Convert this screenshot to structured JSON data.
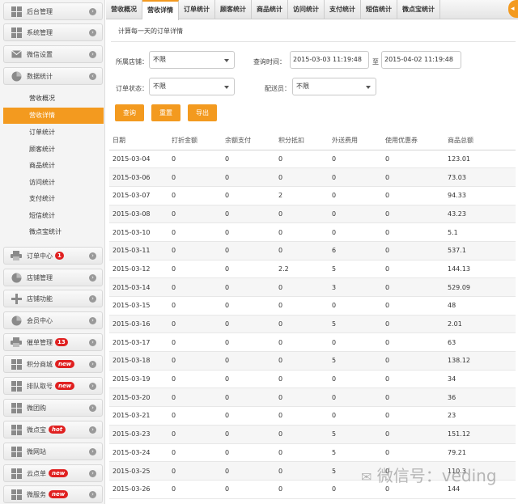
{
  "sidebar": {
    "items": [
      {
        "label": "后台管理",
        "icon": "grid-icon"
      },
      {
        "label": "系统管理",
        "icon": "grid-icon"
      },
      {
        "label": "微信设置",
        "icon": "mail-icon"
      },
      {
        "label": "数据统计",
        "icon": "pie-chart-icon"
      }
    ],
    "sub_items": [
      "营收概况",
      "营收详情",
      "订单统计",
      "顾客统计",
      "商品统计",
      "访问统计",
      "支付统计",
      "短信统计",
      "微点宝统计"
    ],
    "items_lower": [
      {
        "label": "订单中心",
        "icon": "printer-icon",
        "badge": "1"
      },
      {
        "label": "店铺管理",
        "icon": "pie-chart-icon"
      },
      {
        "label": "店铺功能",
        "icon": "plus-icon"
      },
      {
        "label": "会员中心",
        "icon": "pie-chart-icon"
      },
      {
        "label": "催单管理",
        "icon": "printer-icon",
        "badge": "13"
      },
      {
        "label": "积分商城",
        "icon": "grid-icon",
        "new": "new"
      },
      {
        "label": "排队取号",
        "icon": "grid-icon",
        "new": "new"
      },
      {
        "label": "微团购",
        "icon": "grid-icon"
      },
      {
        "label": "微点宝",
        "icon": "grid-icon",
        "new": "hot"
      },
      {
        "label": "微网站",
        "icon": "grid-icon"
      },
      {
        "label": "云点单",
        "icon": "grid-icon",
        "new": "new"
      },
      {
        "label": "微服务",
        "icon": "grid-icon",
        "new": "new"
      }
    ]
  },
  "tabs": [
    "营收概况",
    "营收详情",
    "订单统计",
    "顾客统计",
    "商品统计",
    "访问统计",
    "支付统计",
    "短信统计",
    "微点宝统计"
  ],
  "page": {
    "description": "计算每一天的订单详情",
    "store_label": "所属店铺：",
    "store_value": "不限",
    "query_time_label": "查询时间：",
    "start_time": "2015-03-03 11:19:48",
    "to_label": "至",
    "end_time": "2015-04-02 11:19:48",
    "order_status_label": "订单状态：",
    "order_status_value": "不限",
    "courier_label": "配送员：",
    "courier_value": "不限",
    "query_button": "查询",
    "reset_button": "重置",
    "export_button": "导出"
  },
  "table": {
    "headers": [
      "日期",
      "打折金额",
      "余额支付",
      "积分抵扣",
      "外送费用",
      "使用优惠券",
      "商品总额"
    ],
    "rows": [
      [
        "2015-03-04",
        "0",
        "0",
        "0",
        "0",
        "0",
        "123.01"
      ],
      [
        "2015-03-06",
        "0",
        "0",
        "0",
        "0",
        "0",
        "73.03"
      ],
      [
        "2015-03-07",
        "0",
        "0",
        "2",
        "0",
        "0",
        "94.33"
      ],
      [
        "2015-03-08",
        "0",
        "0",
        "0",
        "0",
        "0",
        "43.23"
      ],
      [
        "2015-03-10",
        "0",
        "0",
        "0",
        "0",
        "0",
        "5.1"
      ],
      [
        "2015-03-11",
        "0",
        "0",
        "0",
        "6",
        "0",
        "537.1"
      ],
      [
        "2015-03-12",
        "0",
        "0",
        "2.2",
        "5",
        "0",
        "144.13"
      ],
      [
        "2015-03-14",
        "0",
        "0",
        "0",
        "3",
        "0",
        "529.09"
      ],
      [
        "2015-03-15",
        "0",
        "0",
        "0",
        "0",
        "0",
        "48"
      ],
      [
        "2015-03-16",
        "0",
        "0",
        "0",
        "5",
        "0",
        "2.01"
      ],
      [
        "2015-03-17",
        "0",
        "0",
        "0",
        "0",
        "0",
        "63"
      ],
      [
        "2015-03-18",
        "0",
        "0",
        "0",
        "5",
        "0",
        "138.12"
      ],
      [
        "2015-03-19",
        "0",
        "0",
        "0",
        "0",
        "0",
        "34"
      ],
      [
        "2015-03-20",
        "0",
        "0",
        "0",
        "0",
        "0",
        "36"
      ],
      [
        "2015-03-21",
        "0",
        "0",
        "0",
        "0",
        "0",
        "23"
      ],
      [
        "2015-03-23",
        "0",
        "0",
        "0",
        "5",
        "0",
        "151.12"
      ],
      [
        "2015-03-24",
        "0",
        "0",
        "0",
        "5",
        "0",
        "79.21"
      ],
      [
        "2015-03-25",
        "0",
        "0",
        "0",
        "5",
        "0",
        "110.3"
      ],
      [
        "2015-03-26",
        "0",
        "0",
        "0",
        "0",
        "0",
        "144"
      ]
    ]
  },
  "watermark": "微信号：veding",
  "colors": {
    "accent": "#f39a1f",
    "badge": "#e02020"
  }
}
